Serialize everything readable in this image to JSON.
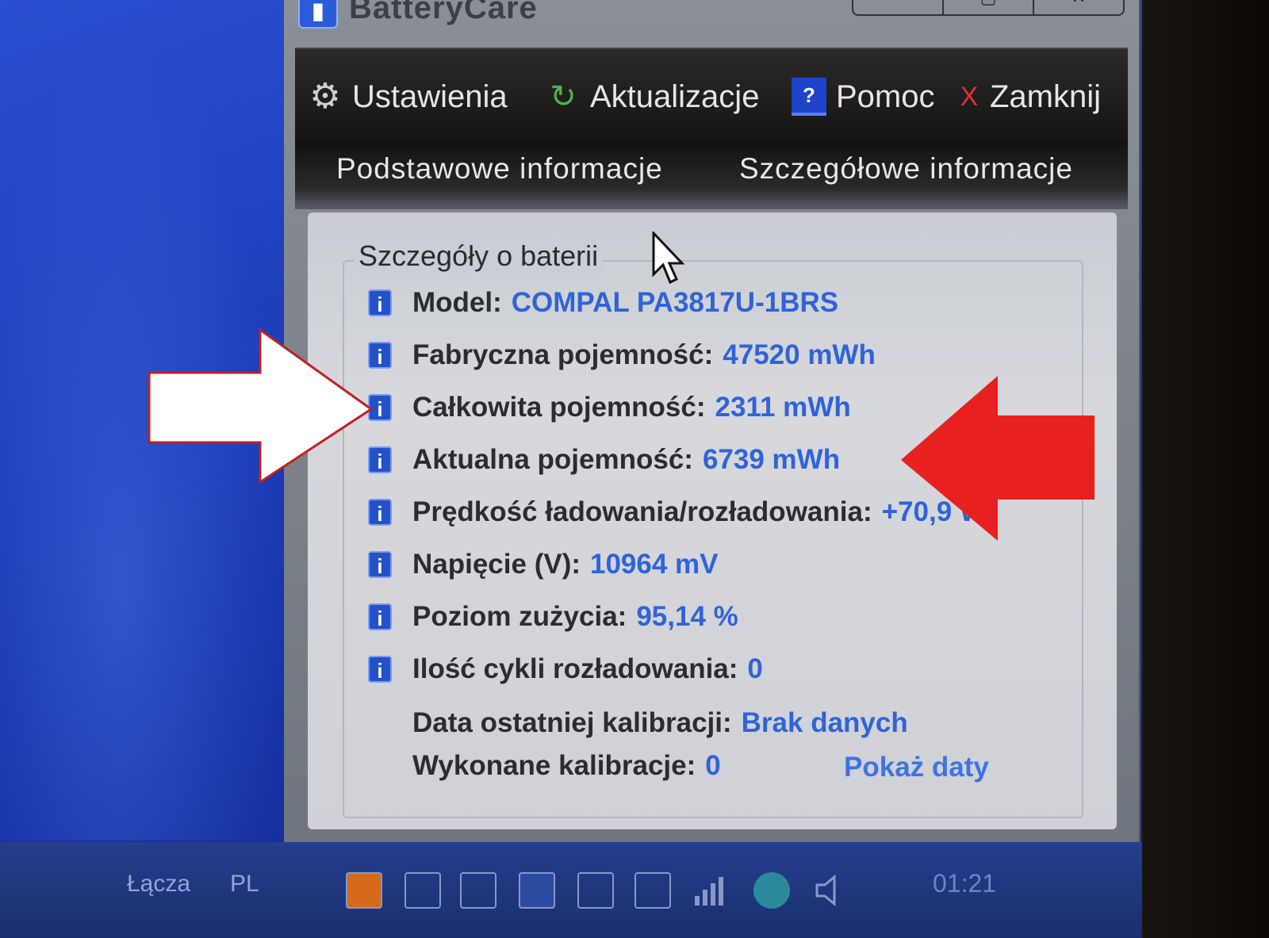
{
  "window": {
    "title": "BatteryCare",
    "app_icon": "battery-icon"
  },
  "menu": {
    "settings": "Ustawienia",
    "updates": "Aktualizacje",
    "help": "Pomoc",
    "close": "Zamknij",
    "help_glyph": "?",
    "close_glyph": "X"
  },
  "tabs": {
    "basic": "Podstawowe informacje",
    "detailed": "Szczegółowe informacje"
  },
  "details": {
    "group_title": "Szczegóły o baterii",
    "info_glyph": "i",
    "rows": [
      {
        "label": "Model:",
        "value": "COMPAL  PA3817U-1BRS"
      },
      {
        "label": "Fabryczna pojemność:",
        "value": "47520 mWh"
      },
      {
        "label": "Całkowita pojemność:",
        "value": "2311 mWh"
      },
      {
        "label": "Aktualna pojemność:",
        "value": "6739 mWh"
      },
      {
        "label": "Prędkość ładowania/rozładowania:",
        "value": "+70,9 W"
      },
      {
        "label": "Napięcie (V):",
        "value": "10964 mV"
      },
      {
        "label": "Poziom zużycia:",
        "value": "95,14 %"
      },
      {
        "label": "Ilość cykli rozładowania:",
        "value": "0"
      }
    ],
    "calibration_date_label": "Data ostatniej kalibracji:",
    "calibration_date_value": "Brak danych",
    "calibrations_label": "Wykonane kalibracje:",
    "calibrations_value": "0",
    "show_dates_link": "Pokaż daty"
  },
  "taskbar": {
    "links": "Łącza",
    "language": "PL",
    "clock": "01:21"
  },
  "colors": {
    "value_blue": "#2f63d8",
    "annotation_white_arrow": "#ffffff",
    "annotation_red_arrow": "#e82020"
  }
}
